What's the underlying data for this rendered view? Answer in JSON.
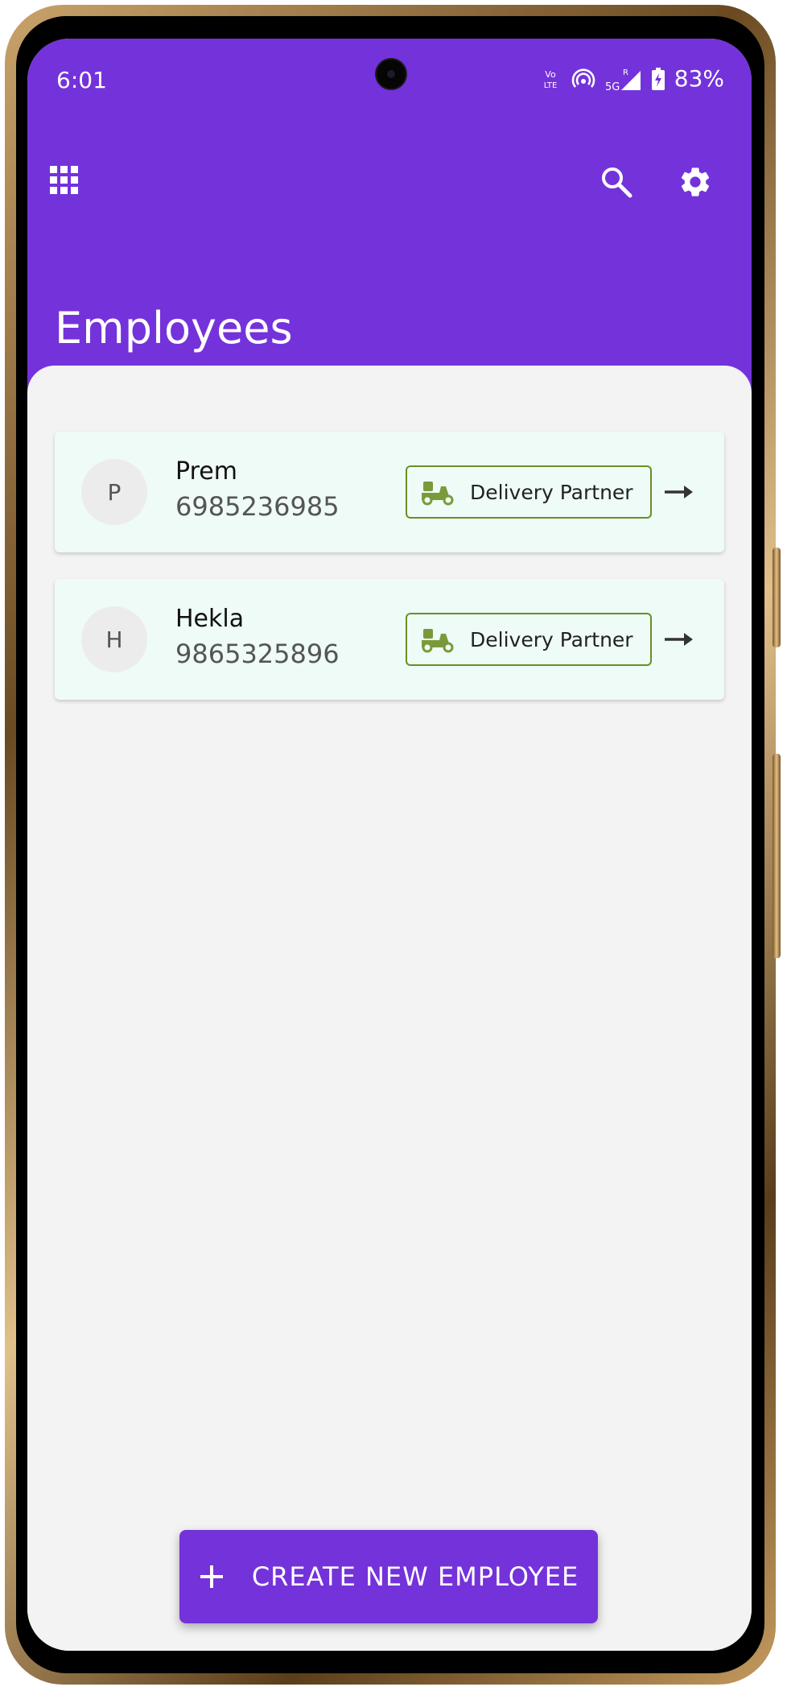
{
  "status_bar": {
    "time": "6:01",
    "volte_label": "Vo LTE",
    "network_label": "5G",
    "battery_percent": "83%"
  },
  "toolbar": {
    "apps_icon": "grid-icon",
    "search_icon": "search-icon",
    "settings_icon": "gear-icon"
  },
  "page": {
    "title": "Employees"
  },
  "employees": [
    {
      "initial": "P",
      "name": "Prem",
      "phone": "6985236985",
      "role": "Delivery Partner",
      "role_icon": "scooter-icon"
    },
    {
      "initial": "H",
      "name": "Hekla",
      "phone": "9865325896",
      "role": "Delivery Partner",
      "role_icon": "scooter-icon"
    }
  ],
  "fab": {
    "label": "CREATE NEW EMPLOYEE",
    "icon": "plus-icon"
  },
  "colors": {
    "primary": "#7432db",
    "card_background": "#effbf7",
    "badge_border": "#6b8e23",
    "badge_icon": "#7a9a3a",
    "content_background": "#f3f3f3"
  }
}
